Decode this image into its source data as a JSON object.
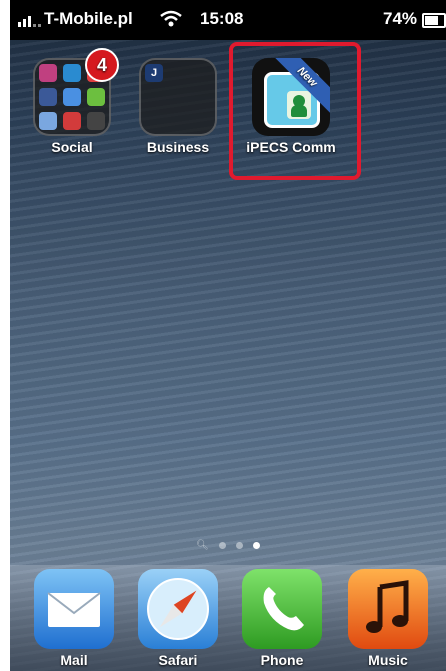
{
  "status_bar": {
    "carrier": "T-Mobile.pl",
    "time": "15:08",
    "battery": "74%"
  },
  "home_apps": [
    {
      "label": "Social",
      "badge": "4",
      "icon": "folder-icon"
    },
    {
      "label": "Business",
      "icon": "folder-icon"
    },
    {
      "label": "iPECS Comm",
      "icon": "ipecs-comm-icon",
      "ribbon": "New",
      "highlight_color": "#e01a2e"
    }
  ],
  "page_indicator": {
    "pages": 3,
    "active_index": 2
  },
  "dock": [
    {
      "label": "Mail",
      "icon": "mail-icon"
    },
    {
      "label": "Safari",
      "icon": "safari-compass-icon"
    },
    {
      "label": "Phone",
      "icon": "phone-icon"
    },
    {
      "label": "Music",
      "icon": "music-note-icon"
    }
  ]
}
